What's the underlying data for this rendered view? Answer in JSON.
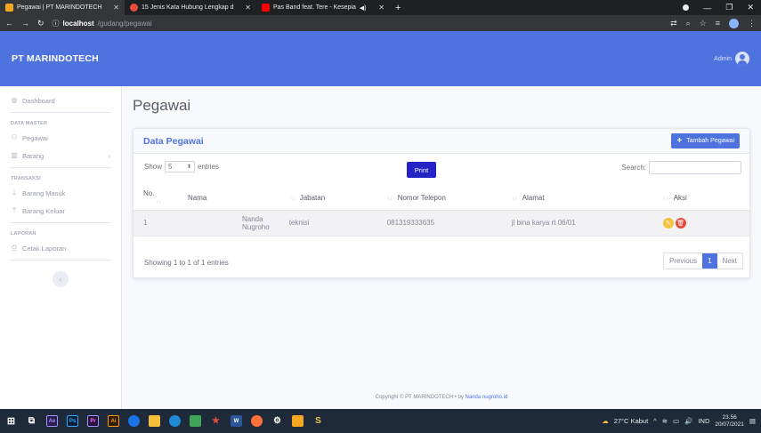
{
  "browser": {
    "tabs": [
      {
        "title": "Pegawai | PT MARINDOTECH",
        "active": true
      },
      {
        "title": "15 Jenis Kata Hubung Lengkap d",
        "active": false
      },
      {
        "title": "Pas Band feat. Tere - Kesepia",
        "active": false
      }
    ],
    "new_tab": "+",
    "url_host": "localhost",
    "url_path": "/gudang/pegawai"
  },
  "app": {
    "brand": "PT MARINDOTECH",
    "user_name": "Admin",
    "accent_color": "#4e73df"
  },
  "sidebar": {
    "dashboard": "Dashboard",
    "section_master": "DATA MASTER",
    "pegawai": "Pegawai",
    "barang": "Barang",
    "section_transaksi": "TRANSAKSI",
    "barang_masuk": "Barang Masuk",
    "barang_keluar": "Barang Keluar",
    "section_laporan": "LAPORAN",
    "cetak_laporan": "Cetak Laporan"
  },
  "main": {
    "page_title": "Pegawai",
    "card_title": "Data Pegawai",
    "add_button": "Tambah Pegawai",
    "show_label": "Show",
    "entries_value": "5",
    "entries_label": "entries",
    "print_button": "Print",
    "search_label": "Search:",
    "table": {
      "headers": [
        "No.",
        "Nama",
        "Jabatan",
        "Nomor Telepon",
        "Alamat",
        "Aksi"
      ],
      "rows": [
        {
          "no": "1",
          "nama": "Nanda Nugroho",
          "jabatan": "teknisi",
          "telepon": "081319333635",
          "alamat": "jl bina karya rt 06/01"
        }
      ]
    },
    "info": "Showing 1 to 1 of 1 entries",
    "pagination": {
      "previous": "Previous",
      "current": "1",
      "next": "Next"
    }
  },
  "footer": {
    "copyright": "Copyright © PT MARINDOTECH • by",
    "author": "Nanda nugroho.id"
  },
  "taskbar": {
    "weather": "27°C Kabut",
    "lang": "IND",
    "time": "23.56",
    "date": "20/07/2021"
  }
}
